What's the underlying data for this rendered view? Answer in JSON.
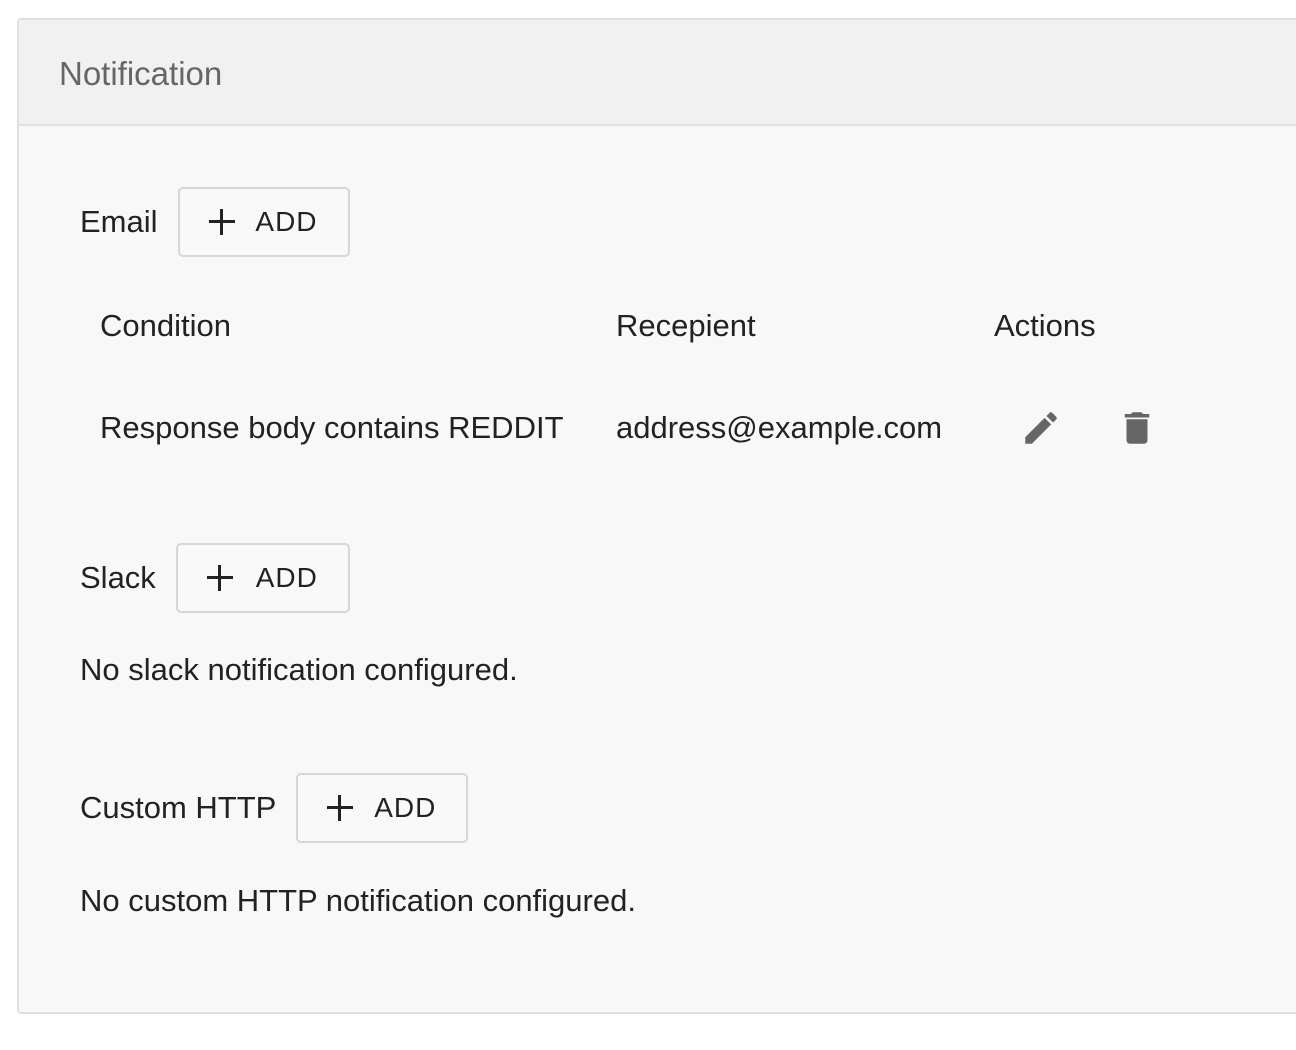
{
  "panel": {
    "title": "Notification"
  },
  "email": {
    "label": "Email",
    "add_label": "ADD",
    "table": {
      "headers": [
        "Condition",
        "Recepient",
        "Actions"
      ],
      "rows": [
        {
          "condition": "Response body contains REDDIT",
          "recipient": "address@example.com",
          "actions": [
            "pencil-icon",
            "trash-icon"
          ]
        }
      ]
    }
  },
  "slack": {
    "label": "Slack",
    "add_label": "ADD",
    "empty_message": "No slack notification configured."
  },
  "custom_http": {
    "label": "Custom HTTP",
    "add_label": "ADD",
    "empty_message": "No custom HTTP notification configured."
  },
  "colors": {
    "panel_bg": "#f8f8f8",
    "header_bg": "#f1f1f1",
    "border": "#e0e0e0",
    "icon": "#666666"
  }
}
